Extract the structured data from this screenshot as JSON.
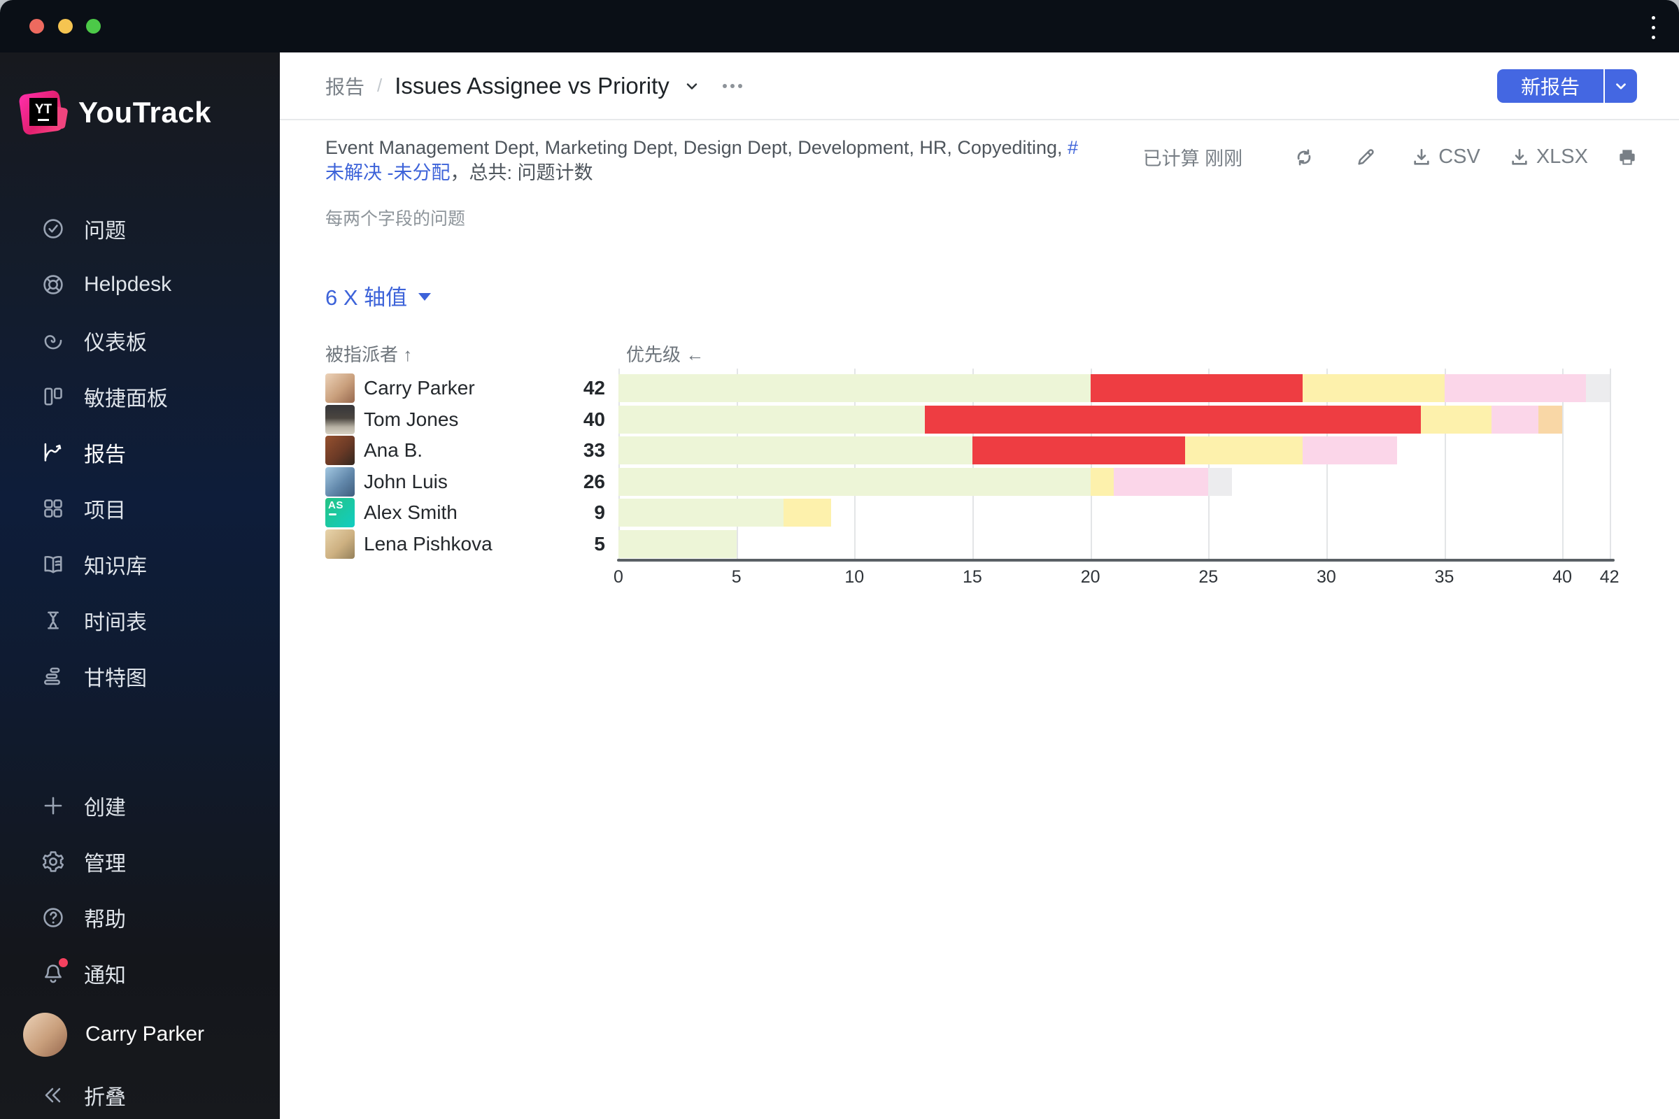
{
  "colors": {
    "accent_blue": "#4467e2",
    "link_blue": "#3d63d9",
    "notification_red": "#f5415f"
  },
  "window": {
    "titlebar_menu_icon": "kebab-menu"
  },
  "sidebar": {
    "logo_text": "YouTrack",
    "logo_mark": "YT",
    "nav_items": [
      {
        "label": "问题",
        "icon": "check-circle-icon",
        "active": false
      },
      {
        "label": "Helpdesk",
        "icon": "lifebuoy-icon",
        "active": false
      },
      {
        "label": "仪表板",
        "icon": "gauge-icon",
        "active": false
      },
      {
        "label": "敏捷面板",
        "icon": "agile-board-icon",
        "active": false
      },
      {
        "label": "报告",
        "icon": "report-chart-icon",
        "active": true
      },
      {
        "label": "项目",
        "icon": "projects-grid-icon",
        "active": false
      },
      {
        "label": "知识库",
        "icon": "book-icon",
        "active": false
      },
      {
        "label": "时间表",
        "icon": "hourglass-icon",
        "active": false
      },
      {
        "label": "甘特图",
        "icon": "gantt-icon",
        "active": false
      }
    ],
    "footer_items": [
      {
        "label": "创建",
        "icon": "plus-icon",
        "badge": false
      },
      {
        "label": "管理",
        "icon": "gear-icon",
        "badge": false
      },
      {
        "label": "帮助",
        "icon": "help-circle-icon",
        "badge": false
      },
      {
        "label": "通知",
        "icon": "bell-icon",
        "badge": true
      }
    ],
    "user": {
      "name": "Carry Parker",
      "avatar": "carry"
    },
    "collapse_label": "折叠"
  },
  "header": {
    "breadcrumb_root": "报告",
    "breadcrumb_separator": "/",
    "title": "Issues Assignee vs Priority",
    "new_report_label": "新报告"
  },
  "toolbar": {
    "calculated_label": "已计算 刚刚",
    "csv_label": "CSV",
    "xlsx_label": "XLSX"
  },
  "report": {
    "filters_prefix": "Event Management Dept, Marketing Dept, Design Dept, Development, HR, Copyediting, ",
    "filters_link": "#未解决 -未分配",
    "filters_suffix": "，总共: 问题计数",
    "subtitle": "每两个字段的问题",
    "axis_selector_label": "6 X 轴值",
    "column_left_header": "被指派者 ↑",
    "column_right_header": "优先级 ←"
  },
  "chart_data": {
    "type": "bar",
    "stacked": true,
    "orientation": "horizontal",
    "title": "Issues Assignee vs Priority",
    "xlabel": "优先级",
    "ylabel": "被指派者",
    "xlim": [
      0,
      42
    ],
    "x_ticks": [
      0,
      5,
      10,
      15,
      20,
      25,
      30,
      35,
      40,
      42
    ],
    "grid": true,
    "legend": "none",
    "categories": [
      "Carry Parker",
      "Tom Jones",
      "Ana B.",
      "John Luis",
      "Alex Smith",
      "Lena Pishkova"
    ],
    "totals": [
      42,
      40,
      33,
      26,
      9,
      5
    ],
    "avatars": [
      {
        "style": "carry",
        "initials": ""
      },
      {
        "style": "tom",
        "initials": ""
      },
      {
        "style": "ana",
        "initials": ""
      },
      {
        "style": "john",
        "initials": ""
      },
      {
        "style": "alex",
        "initials": "AS"
      },
      {
        "style": "lena",
        "initials": ""
      }
    ],
    "series": [
      {
        "name": "priority-green",
        "color": "#edf5d7",
        "values": [
          20,
          13,
          15,
          20,
          7,
          5
        ]
      },
      {
        "name": "priority-red",
        "color": "#ee3d42",
        "values": [
          9,
          21,
          9,
          0,
          0,
          0
        ]
      },
      {
        "name": "priority-yellow",
        "color": "#fdf1ac",
        "values": [
          6,
          3,
          5,
          1,
          2,
          0
        ]
      },
      {
        "name": "priority-pink",
        "color": "#fbd6e9",
        "values": [
          6,
          2,
          4,
          4,
          0,
          0
        ]
      },
      {
        "name": "priority-orange",
        "color": "#f9d7a6",
        "values": [
          0,
          1,
          0,
          0,
          0,
          0
        ]
      },
      {
        "name": "priority-gray",
        "color": "#ececee",
        "values": [
          1,
          0,
          0,
          1,
          0,
          0
        ]
      }
    ]
  }
}
